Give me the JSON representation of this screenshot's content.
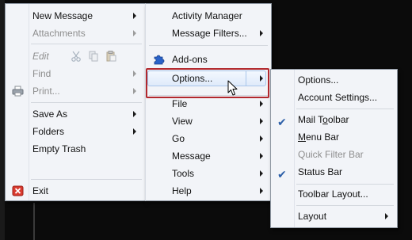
{
  "file_menu": {
    "items": [
      {
        "label": "New Message",
        "has_submenu": true
      },
      {
        "label": "Attachments",
        "has_submenu": true,
        "disabled": true
      },
      {
        "label": "Edit",
        "has_submenu": true,
        "disabled": true
      },
      {
        "label": "Find",
        "has_submenu": true,
        "disabled": true
      },
      {
        "label": "Print...",
        "has_submenu": true,
        "disabled": true
      },
      {
        "label": "Save As",
        "has_submenu": true
      },
      {
        "label": "Folders",
        "has_submenu": true
      },
      {
        "label": "Empty Trash"
      },
      {
        "label": "Exit"
      }
    ]
  },
  "app_menu": {
    "items": [
      {
        "label": "Activity Manager"
      },
      {
        "label": "Message Filters...",
        "has_submenu": true
      },
      {
        "label": "Add-ons"
      },
      {
        "label": "Options...",
        "has_submenu": true,
        "highlighted": true
      },
      {
        "label": "File",
        "has_submenu": true
      },
      {
        "label": "View",
        "has_submenu": true
      },
      {
        "label": "Go",
        "has_submenu": true
      },
      {
        "label": "Message",
        "has_submenu": true
      },
      {
        "label": "Tools",
        "has_submenu": true
      },
      {
        "label": "Help",
        "has_submenu": true
      }
    ]
  },
  "options_submenu": {
    "items": [
      {
        "label": "Options..."
      },
      {
        "label": "Account Settings..."
      },
      {
        "label_parts": [
          "Mail T",
          "o",
          "olbar"
        ],
        "checked": true
      },
      {
        "label_parts": [
          "",
          "M",
          "enu Bar"
        ],
        "checked": false
      },
      {
        "label": "Quick Filter Bar",
        "disabled": true
      },
      {
        "label": "Status Bar",
        "checked": true
      },
      {
        "label": "Toolbar Layout..."
      },
      {
        "label": "Layout",
        "has_submenu": true
      }
    ]
  },
  "icons": {
    "addons": "puzzle-piece-icon",
    "exit": "red-x-icon",
    "print": "printer-icon",
    "check": "✔",
    "cursor": "mouse-pointer-icon"
  },
  "colors": {
    "highlight_border": "#a9c6ea",
    "annotation_outline": "#b2282d",
    "check_color": "#2c5fa8"
  }
}
